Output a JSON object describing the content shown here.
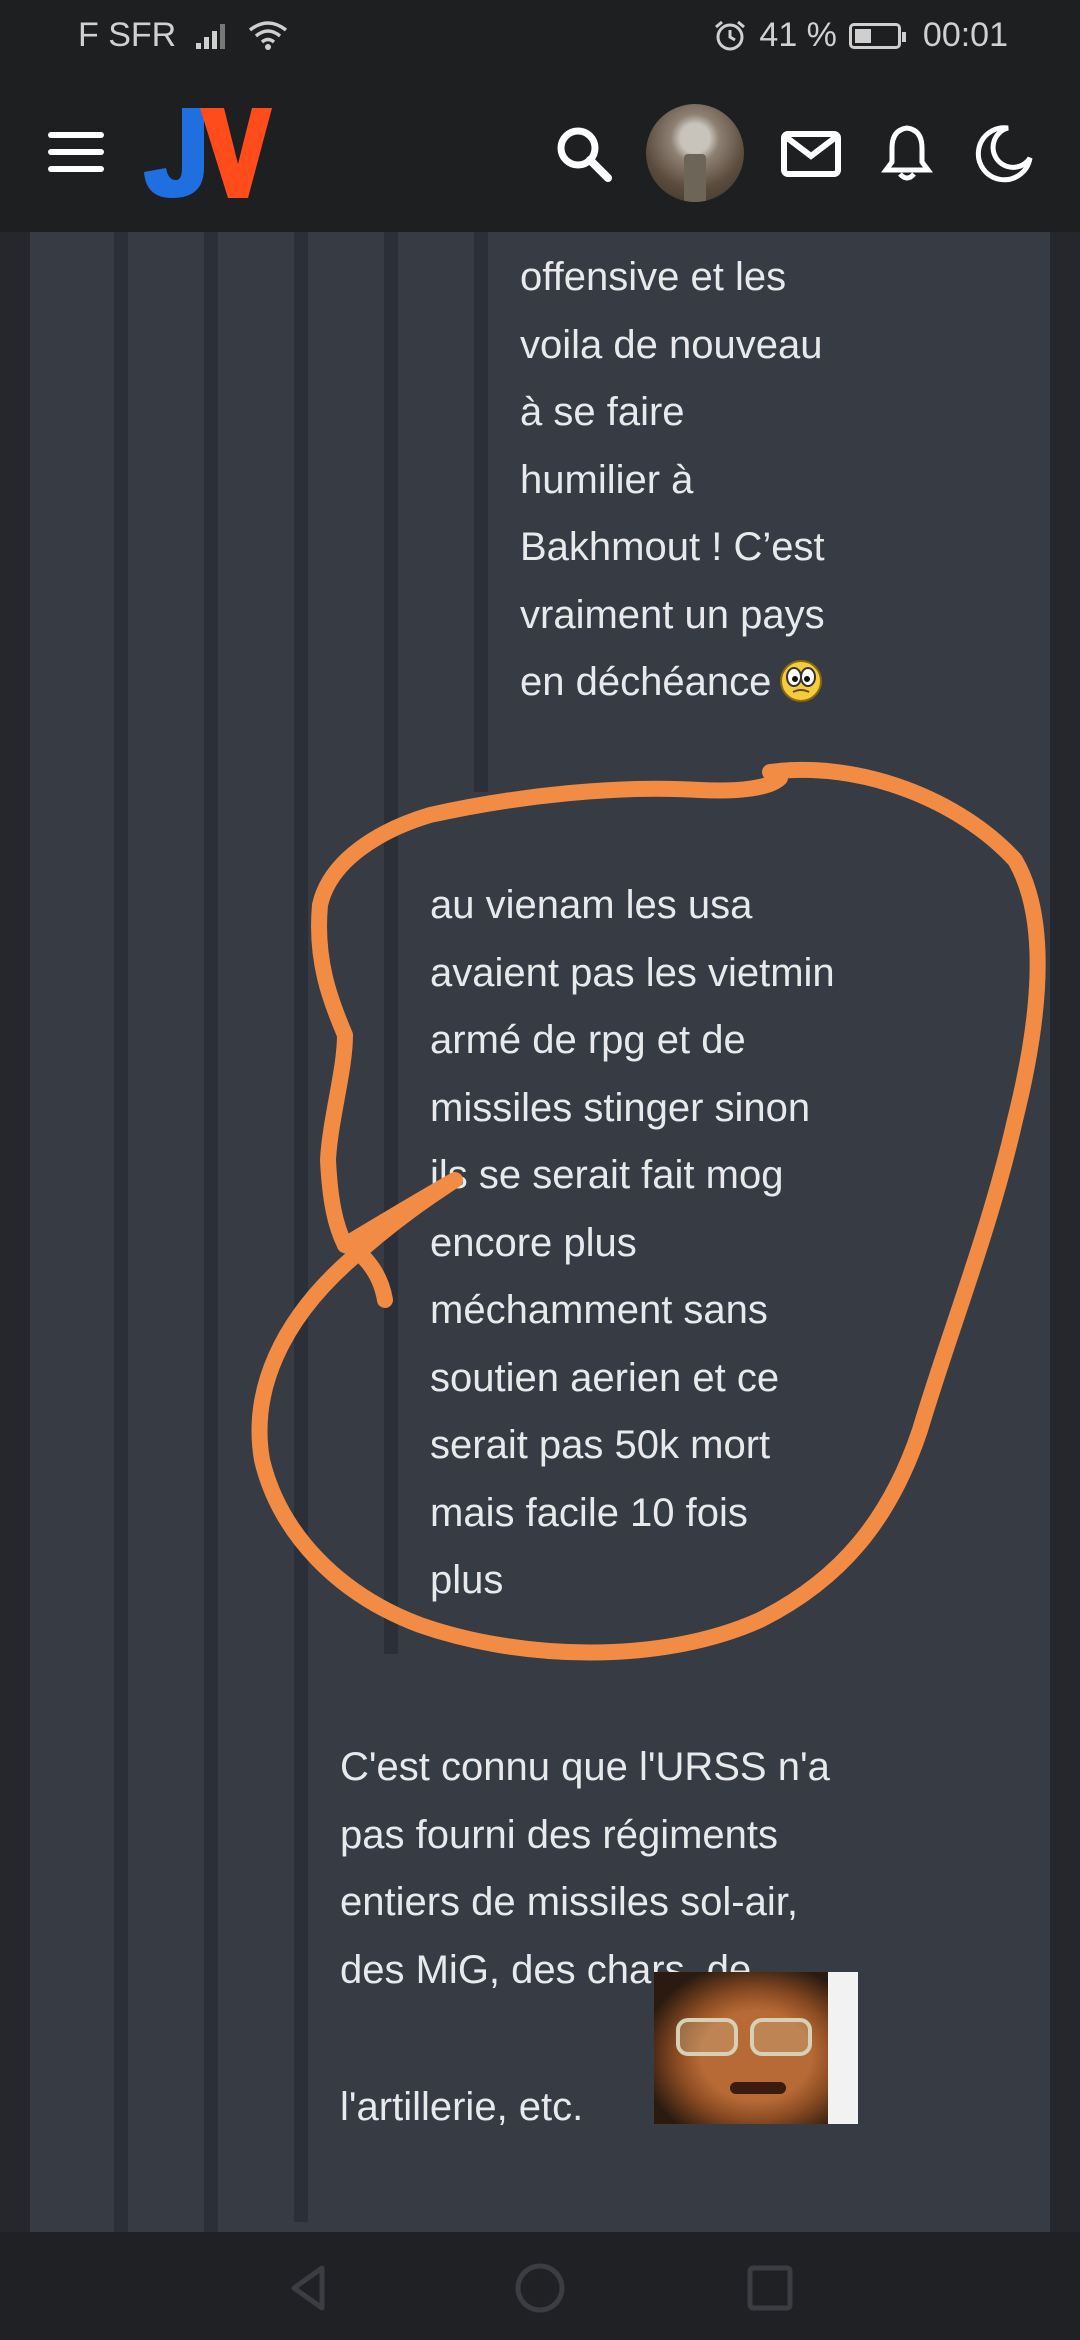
{
  "status_bar": {
    "carrier": "F SFR",
    "battery_percent": "41 %",
    "battery_level": 0.41,
    "time": "00:01"
  },
  "header": {
    "logo_text": "JV",
    "icons": [
      "menu-icon",
      "search-icon",
      "avatar",
      "mail-icon",
      "bell-icon",
      "moon-icon"
    ],
    "logo_colors": {
      "j": "#1f6fe0",
      "v": "#ff4c1a"
    }
  },
  "posts": {
    "quote_level3": [
      "offensive et les",
      "voila de nouveau",
      "à se faire",
      "humilier à",
      "Bakhmout ! C’est",
      "vraiment un pays",
      "en déchéance"
    ],
    "quote_level2": [
      "au vienam les usa",
      "avaient pas les vietmin",
      "armé de rpg et de",
      "missiles stinger sinon",
      "ils se serait fait mog",
      "encore plus",
      "méchamment sans",
      "soutien aerien et ce",
      "serait pas 50k mort",
      "mais facile 10 fois",
      "plus"
    ],
    "reply": [
      "C'est connu que l'URSS n'a",
      "pas fourni des régiments",
      "entiers de missiles sol-air,",
      "des MiG, des chars, de",
      "l'artillerie, etc."
    ]
  },
  "colors": {
    "background": "#25272c",
    "content_bg": "#363b44",
    "thread_line": "#2b3038",
    "text": "#e8e9eb",
    "annotation": "#f28c45"
  }
}
